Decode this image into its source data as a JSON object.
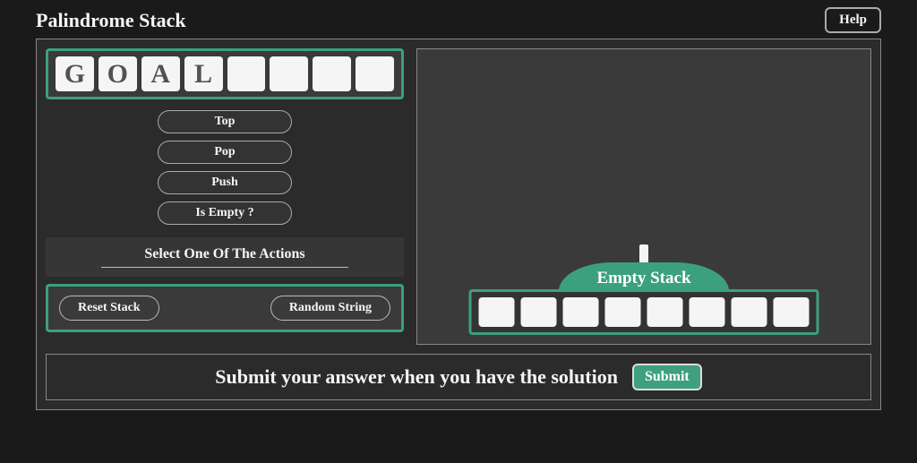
{
  "header": {
    "title": "Palindrome Stack",
    "help_label": "Help"
  },
  "goal": {
    "tiles": [
      "G",
      "O",
      "A",
      "L",
      "",
      "",
      "",
      ""
    ]
  },
  "actions": {
    "items": [
      "Top",
      "Pop",
      "Push",
      "Is Empty ?"
    ],
    "select_label": "Select One Of The Actions"
  },
  "controls": {
    "reset_label": "Reset Stack",
    "random_label": "Random String"
  },
  "stack": {
    "label": "Empty Stack",
    "result_tiles": 8
  },
  "submit": {
    "text": "Submit your answer when you have the solution",
    "button_label": "Submit"
  }
}
